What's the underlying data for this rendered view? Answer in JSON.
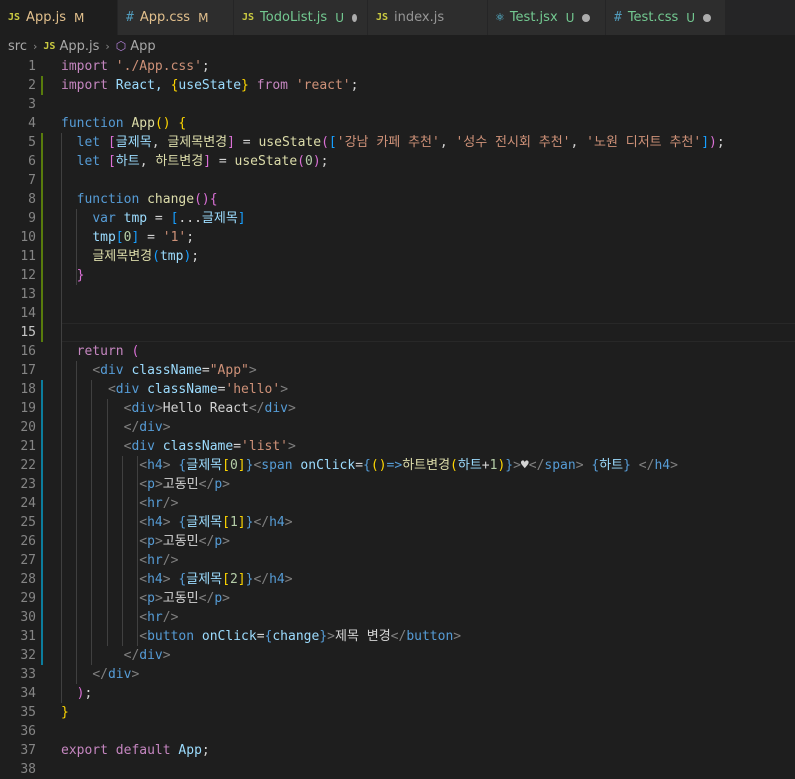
{
  "tabs": [
    {
      "name": "App.js",
      "type": "js",
      "status": "M",
      "active": true
    },
    {
      "name": "App.css",
      "type": "css",
      "status": "M"
    },
    {
      "name": "TodoList.js",
      "type": "js",
      "status": "U",
      "unsaved": true
    },
    {
      "name": "index.js",
      "type": "js",
      "status": ""
    },
    {
      "name": "Test.jsx",
      "type": "react",
      "status": "U",
      "unsaved": true
    },
    {
      "name": "Test.css",
      "type": "css",
      "status": "U",
      "unsaved": true
    }
  ],
  "breadcrumb": {
    "folder": "src",
    "file": "App.js",
    "symbol": "App",
    "file_icon": "JS"
  },
  "icons": {
    "js": "JS",
    "css": "#",
    "react": "⚛",
    "symbol": "⬡",
    "chevron": "›"
  },
  "code": {
    "l1": [
      "import",
      " ",
      "'./App.css'",
      ";"
    ],
    "l2": [
      "import",
      " React, ",
      "{",
      "useState",
      "}",
      " ",
      "from",
      " ",
      "'react'",
      ";"
    ],
    "l4": [
      "function",
      " ",
      "App",
      "()",
      " ",
      "{"
    ],
    "l5": [
      "let",
      " ",
      "[",
      "글제목",
      ", ",
      "글제목변경",
      "]",
      " = ",
      "useState",
      "(",
      "[",
      "'강남 카페 추천'",
      ", ",
      "'성수 전시회 추천'",
      ", ",
      "'노원 디저트 추천'",
      "]",
      ")",
      ";"
    ],
    "l6": [
      "let",
      " ",
      "[",
      "하트",
      ", ",
      "하트변경",
      "]",
      " = ",
      "useState",
      "(",
      "0",
      ")",
      ";"
    ],
    "l8": [
      "function",
      " ",
      "change",
      "()",
      "{"
    ],
    "l9": [
      "var",
      " ",
      "tmp",
      " = ",
      "[",
      "...",
      "글제목",
      "]"
    ],
    "l10": [
      "tmp",
      "[",
      "0",
      "]",
      " = ",
      "'1'",
      ";"
    ],
    "l11": [
      "글제목변경",
      "(",
      "tmp",
      ")",
      ";"
    ],
    "l12": [
      "}"
    ],
    "l16": [
      "return",
      " ",
      "("
    ],
    "l17": [
      "<",
      "div",
      " ",
      "className",
      "=",
      "\"App\"",
      ">"
    ],
    "l18": [
      "<",
      "div",
      " ",
      "className",
      "=",
      "'hello'",
      ">"
    ],
    "l19": [
      "<",
      "div",
      ">",
      "Hello React",
      "</",
      "div",
      ">"
    ],
    "l20": [
      "</",
      "div",
      ">"
    ],
    "l21": [
      "<",
      "div",
      " ",
      "className",
      "=",
      "'list'",
      ">"
    ],
    "l22": [
      "<",
      "h4",
      ">",
      " ",
      "{",
      "글제목",
      "[",
      "0",
      "]",
      "}",
      "<",
      "span",
      " ",
      "onClick",
      "=",
      "{",
      "()",
      "=>",
      "하트변경",
      "(",
      "하트",
      "+",
      "1",
      ")",
      "}",
      ">",
      "♥",
      "</",
      "span",
      ">",
      " ",
      "{",
      "하트",
      "}",
      " ",
      "</",
      "h4",
      ">"
    ],
    "l23": [
      "<",
      "p",
      ">",
      "고동민",
      "</",
      "p",
      ">"
    ],
    "l24": [
      "<",
      "hr",
      "/>"
    ],
    "l25": [
      "<",
      "h4",
      ">",
      " ",
      "{",
      "글제목",
      "[",
      "1",
      "]",
      "}",
      "</",
      "h4",
      ">"
    ],
    "l26": [
      "<",
      "p",
      ">",
      "고동민",
      "</",
      "p",
      ">"
    ],
    "l27": [
      "<",
      "hr",
      "/>"
    ],
    "l28": [
      "<",
      "h4",
      ">",
      " ",
      "{",
      "글제목",
      "[",
      "2",
      "]",
      "}",
      "</",
      "h4",
      ">"
    ],
    "l29": [
      "<",
      "p",
      ">",
      "고동민",
      "</",
      "p",
      ">"
    ],
    "l30": [
      "<",
      "hr",
      "/>"
    ],
    "l31": [
      "<",
      "button",
      " ",
      "onClick",
      "=",
      "{",
      "change",
      "}",
      ">",
      "제목 변경",
      "</",
      "button",
      ">"
    ],
    "l32": [
      "</",
      "div",
      ">"
    ],
    "l33": [
      "</",
      "div",
      ">"
    ],
    "l34": [
      ")",
      ";"
    ],
    "l35": [
      "}"
    ],
    "l37": [
      "export",
      " ",
      "default",
      " ",
      "App",
      ";"
    ]
  }
}
